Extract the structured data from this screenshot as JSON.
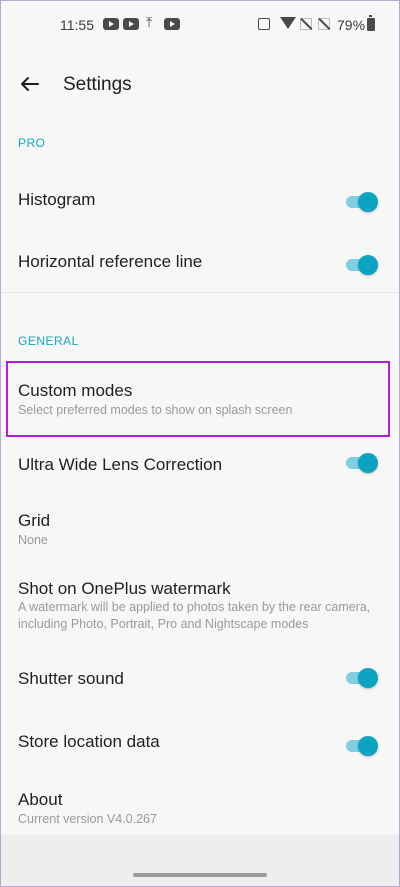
{
  "status_bar": {
    "time": "11:55",
    "battery_text": "79%"
  },
  "header": {
    "title": "Settings"
  },
  "sections": {
    "pro": {
      "label": "PRO",
      "items": [
        {
          "title": "Histogram",
          "toggle_on": true
        },
        {
          "title": "Horizontal reference line",
          "toggle_on": true
        }
      ]
    },
    "general": {
      "label": "GENERAL",
      "items": [
        {
          "title": "Custom modes",
          "subtitle": "Select preferred modes to show on splash screen"
        },
        {
          "title": "Ultra Wide Lens Correction",
          "toggle_on": true
        },
        {
          "title": "Grid",
          "subtitle": "None"
        },
        {
          "title": "Shot on OnePlus watermark",
          "subtitle": "A watermark will be applied to photos taken by the rear camera, including Photo, Portrait, Pro and Nightscape modes"
        },
        {
          "title": "Shutter sound",
          "toggle_on": true
        },
        {
          "title": "Store location data",
          "toggle_on": true
        },
        {
          "title": "About",
          "subtitle": "Current version V4.0.267"
        }
      ]
    }
  },
  "colors": {
    "accent": "#0aa3c2",
    "highlight_border": "#b41dd9",
    "section_label": "#13a6c1"
  }
}
